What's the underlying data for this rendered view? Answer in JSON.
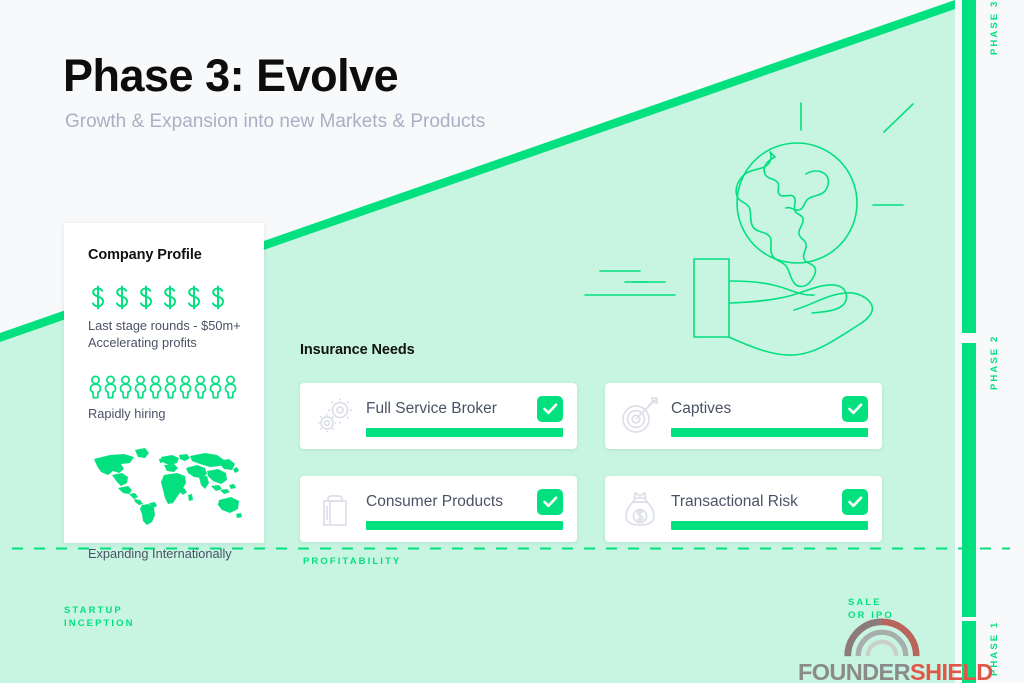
{
  "page": {
    "title": "Phase 3: Evolve",
    "subtitle": "Growth & Expansion into new Markets & Products",
    "accent_color": "#03e07f",
    "background_color": "#f8f9fa",
    "band_color": "#c8f5e2"
  },
  "profile": {
    "heading": "Company Profile",
    "stats": [
      {
        "icon": "dollar-sign-icon",
        "icon_count": 6,
        "text": "Last stage rounds - $50m+\nAccelerating profits",
        "line1": "Last stage rounds - $50m+",
        "line2": "Accelerating profits"
      },
      {
        "icon": "person-icon",
        "icon_count": 10,
        "text": "Rapidly hiring"
      },
      {
        "icon": "world-map-icon",
        "text": "Expanding Internationally"
      }
    ]
  },
  "insurance": {
    "heading": "Insurance Needs",
    "cards": [
      {
        "label": "Full Service Broker",
        "icon": "gears-icon",
        "checked": true,
        "progress": 100
      },
      {
        "label": "Captives",
        "icon": "target-arrow-icon",
        "checked": true,
        "progress": 100
      },
      {
        "label": "Consumer Products",
        "icon": "shopping-bag-icon",
        "checked": true,
        "progress": 100
      },
      {
        "label": "Transactional Risk",
        "icon": "money-bag-icon",
        "checked": true,
        "progress": 100
      }
    ]
  },
  "axes": {
    "profitability": "PROFITABILITY",
    "startup_line1": "STARTUP",
    "startup_line2": "INCEPTION",
    "startup": "STARTUP\nINCEPTION",
    "sale_line1": "SALE",
    "sale_line2": "OR IPO",
    "sale": "SALE\nOR IPO"
  },
  "phases": [
    {
      "label": "PHASE 3"
    },
    {
      "label": "PHASE 2"
    },
    {
      "label": "PHASE 1"
    }
  ],
  "logo": {
    "word1": "FOUNDER",
    "word2": "SHIELD",
    "word1_color": "#8a8a8a",
    "word2_color": "#e0574a"
  }
}
